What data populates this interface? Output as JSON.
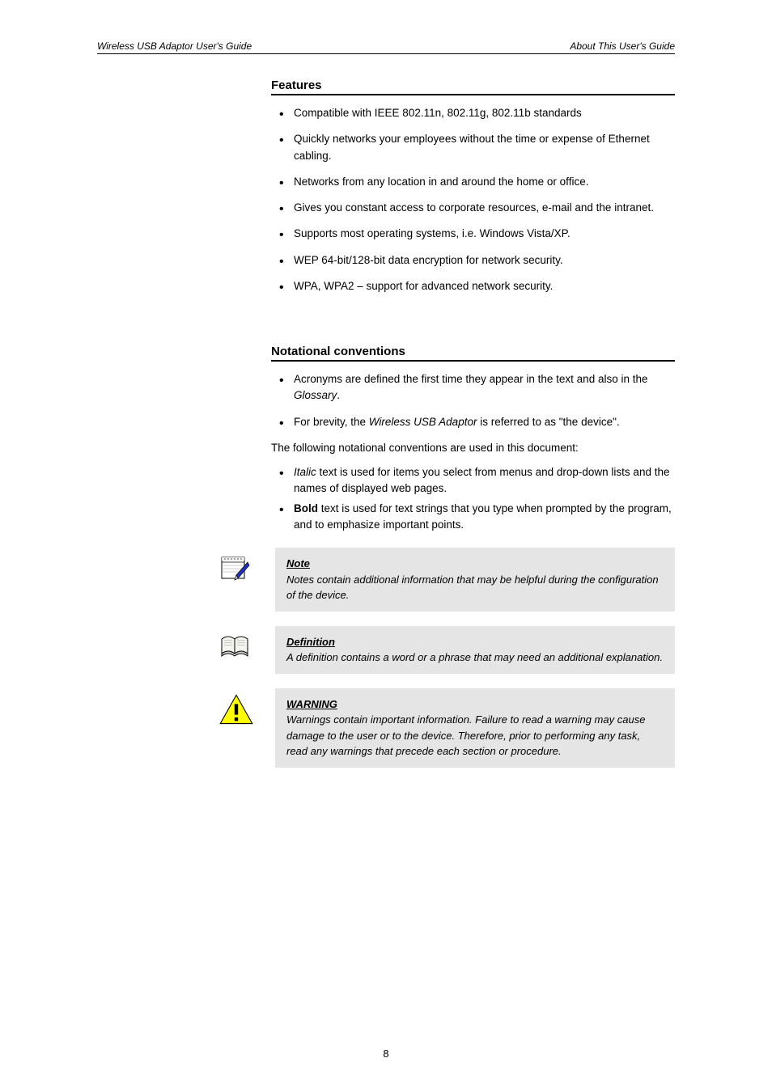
{
  "header": {
    "left": "Wireless USB Adaptor User's Guide",
    "right": "About This User's Guide"
  },
  "section_features": {
    "title": "Features",
    "items": [
      "Compatible with IEEE 802.11n, 802.11g, 802.11b standards",
      "Quickly networks your employees without the time or expense of Ethernet cabling.",
      "Networks from any location in and around the home or office.",
      "Gives you constant access to corporate resources, e-mail and the intranet.",
      "Supports most operating systems, i.e. Windows Vista/XP.",
      "WEP 64-bit/128-bit data encryption for network security.",
      "WPA, WPA2 – support for advanced network security."
    ]
  },
  "section_conventions": {
    "title": "Notational conventions",
    "items_a": [
      {
        "pre": "Acronyms are defined the first time they appear in the text and also in the ",
        "italic": "Glossary",
        "post": "."
      },
      {
        "pre": "For brevity, the ",
        "italic": "Wireless USB Adaptor",
        "post_plain": " is referred to as \"the device\"."
      }
    ],
    "intro_b": "The following notational conventions are used in this document:",
    "items_b": [
      {
        "italic": "Italic ",
        "rest": "text is used for items you select from menus and drop-down lists and the names of displayed web pages."
      },
      {
        "bold": "Bold",
        "rest": " text is used for text strings that you type when prompted by the program, and to emphasize important points."
      }
    ]
  },
  "callouts": {
    "note_label": "Note",
    "note_body": "Notes contain additional information that may be helpful during the configuration of the device.",
    "def_label": "Definition",
    "def_body": "A definition contains a word or a phrase that may need an additional explanation.",
    "warn_label": "WARNING",
    "warn_body": "Warnings contain important information. Failure to read a warning may cause damage to the user or to the device. Therefore, prior to performing any task, read any warnings that precede each section or procedure."
  },
  "page_number": "8"
}
